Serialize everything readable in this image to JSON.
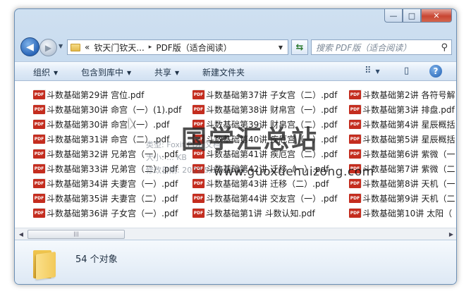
{
  "window": {
    "controls": {
      "minimize": "—",
      "maximize": "□",
      "close": "✕"
    }
  },
  "navigation": {
    "back_icon": "back-arrow-icon",
    "forward_icon": "forward-arrow-icon",
    "address": {
      "overflow": "«",
      "segment1": "钦天门钦天...",
      "separator": "▸",
      "segment2": "PDF版（适合阅读）"
    },
    "search_placeholder": "搜索 PDF版（适合阅读）"
  },
  "toolbar": {
    "organize": "组织",
    "include_library": "包含到库中",
    "share": "共享",
    "new_folder": "新建文件夹"
  },
  "files": [
    {
      "name": "斗数基础第29讲 宫位.pdf"
    },
    {
      "name": "斗数基础第30讲 命宫（一）(1).pdf"
    },
    {
      "name": "斗数基础第30讲 命宫（一）.pdf"
    },
    {
      "name": "斗数基础第31讲 命宫（二）.pdf"
    },
    {
      "name": "斗数基础第32讲 兄弟宫（一）.pdf"
    },
    {
      "name": "斗数基础第33讲 兄弟宫（二）.pdf"
    },
    {
      "name": "斗数基础第34讲 夫妻宫（一）.pdf"
    },
    {
      "name": "斗数基础第35讲 夫妻宫（二）.pdf"
    },
    {
      "name": "斗数基础第36讲 子女宫（一）.pdf"
    },
    {
      "name": "斗数基础第37讲 子女宫（二）.pdf"
    },
    {
      "name": "斗数基础第38讲 财帛宫（一）.pdf"
    },
    {
      "name": "斗数基础第39讲 财帛宫（二）.pdf"
    },
    {
      "name": "斗数基础第40讲 疾厄宫（一）.pdf"
    },
    {
      "name": "斗数基础第41讲 疾厄宫（二）.pdf"
    },
    {
      "name": "斗数基础第42讲 迁移（一）.pdf"
    },
    {
      "name": "斗数基础第43讲 迁移（二）.pdf"
    },
    {
      "name": "斗数基础第44讲 交友宫（一）.pdf"
    },
    {
      "name": "斗数基础第1讲 斗数认知.pdf"
    },
    {
      "name": "斗数基础第2讲 各符号解"
    },
    {
      "name": "斗数基础第3讲 排盘.pdf"
    },
    {
      "name": "斗数基础第4讲 星辰概括"
    },
    {
      "name": "斗数基础第5讲 星辰概括"
    },
    {
      "name": "斗数基础第6讲 紫微（一"
    },
    {
      "name": "斗数基础第7讲 紫微（二"
    },
    {
      "name": "斗数基础第8讲 天机（一"
    },
    {
      "name": "斗数基础第9讲 天机（二"
    },
    {
      "name": "斗数基础第10讲 太阳（"
    }
  ],
  "tooltip": {
    "type_line": "类型: Foxit PDF 文档",
    "size_line": "大小: ... KB",
    "date_line": "修改日期: 2022/5/15 21:42"
  },
  "watermark": {
    "cn": "国学汇总站",
    "url": "www.guoxuehuizong.com"
  },
  "details": {
    "count": "54 个对象"
  }
}
